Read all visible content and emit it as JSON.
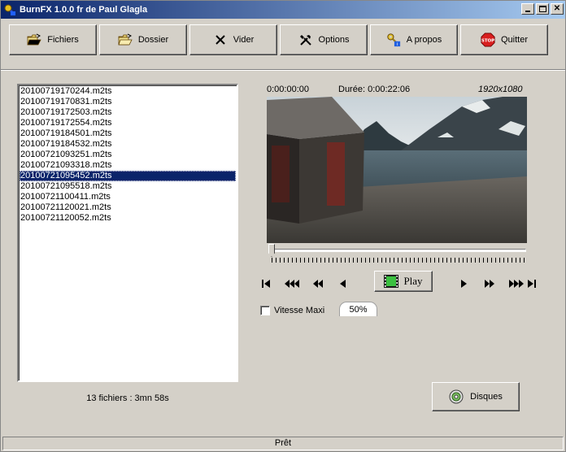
{
  "window": {
    "title": "BurnFX 1.0.0 fr de Paul Glagla"
  },
  "toolbar": {
    "files_label": "Fichiers",
    "folder_label": "Dossier",
    "clear_label": "Vider",
    "options_label": "Options",
    "about_label": "A propos",
    "quit_label": "Quitter",
    "stop_sign_text": "STOP"
  },
  "file_list": {
    "items": [
      "20100719170244.m2ts",
      "20100719170831.m2ts",
      "20100719172503.m2ts",
      "20100719172554.m2ts",
      "20100719184501.m2ts",
      "20100719184532.m2ts",
      "20100721093251.m2ts",
      "20100721093318.m2ts",
      "20100721095452.m2ts",
      "20100721095518.m2ts",
      "20100721100411.m2ts",
      "20100721120021.m2ts",
      "20100721120052.m2ts"
    ],
    "selected_index": 8,
    "summary": "13 fichiers : 3mn 58s"
  },
  "player": {
    "current_time": "0:00:00:00",
    "duration": "Durée: 0:00:22:06",
    "resolution": "1920x1080",
    "play_label": "Play",
    "seek_position": 0,
    "max_speed_label": "Vitesse Maxi",
    "max_speed_checked": false,
    "speed_value": "50%"
  },
  "discs_label": "Disques",
  "status": "Prêt",
  "colors": {
    "title_start": "#0a246a",
    "title_end": "#a6caf0",
    "selection": "#0a246a",
    "face": "#d4d0c8",
    "stop_red": "#d81e1e"
  }
}
